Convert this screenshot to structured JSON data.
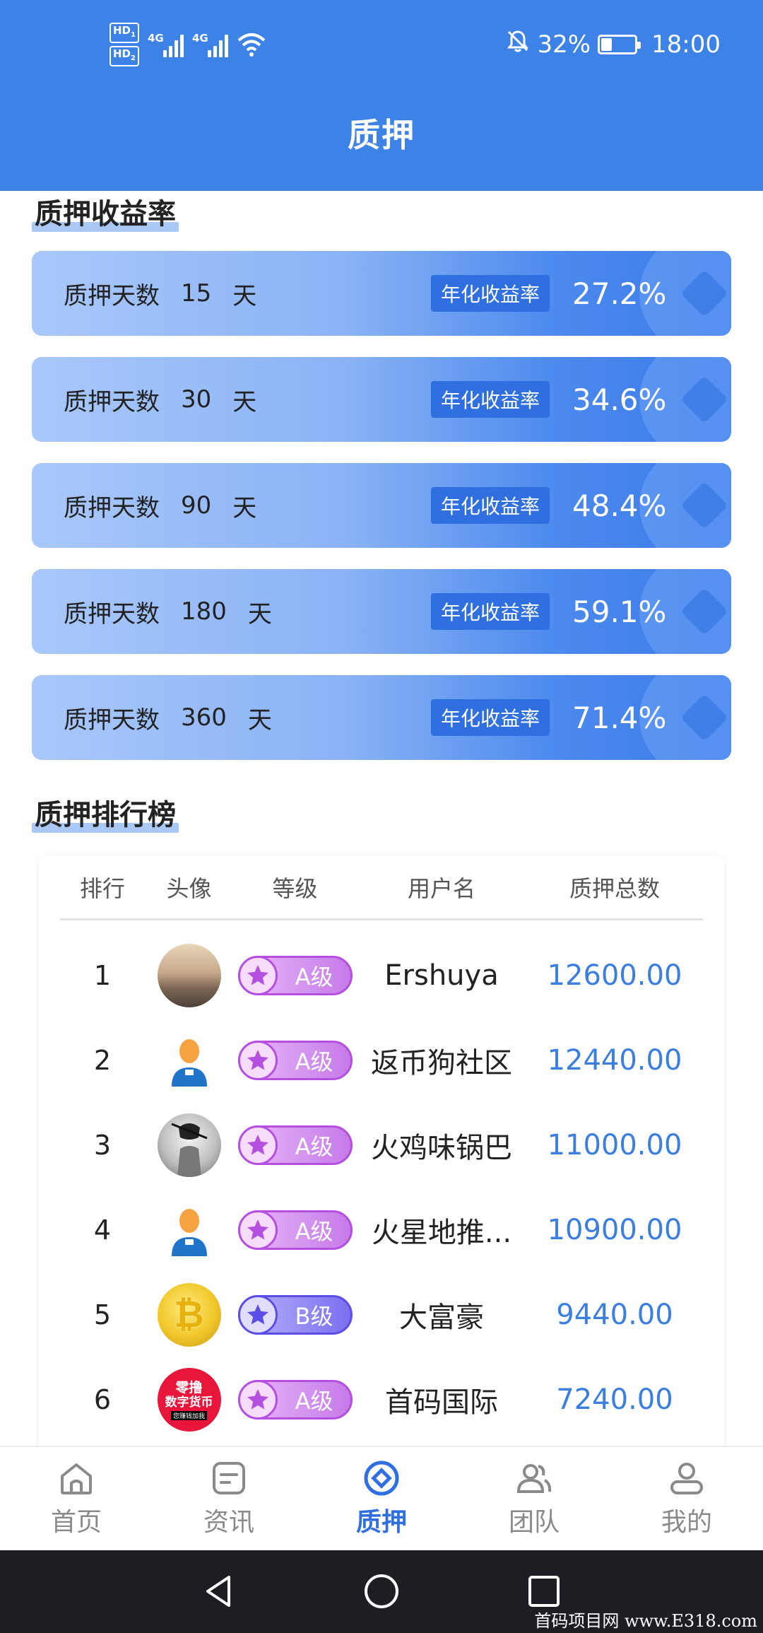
{
  "status_bar": {
    "hd1": "HD",
    "hd1_sub": "1",
    "hd2": "HD",
    "hd2_sub": "2",
    "net1": "4G",
    "net2": "4G",
    "battery": "32%",
    "battery_level": 0.32,
    "time": "18:00",
    "icons": [
      "signal-icon",
      "wifi-icon",
      "mute-bell-icon",
      "battery-icon"
    ]
  },
  "header": {
    "title": "质押"
  },
  "yield_section": {
    "title": "质押收益率",
    "days_label": "质押天数",
    "unit": "天",
    "badge": "年化收益率",
    "items": [
      {
        "days": "15",
        "rate": "27.2%"
      },
      {
        "days": "30",
        "rate": "34.6%"
      },
      {
        "days": "90",
        "rate": "48.4%"
      },
      {
        "days": "180",
        "rate": "59.1%"
      },
      {
        "days": "360",
        "rate": "71.4%"
      }
    ]
  },
  "ranking_section": {
    "title": "质押排行榜",
    "columns": [
      "排行",
      "头像",
      "等级",
      "用户名",
      "质押总数"
    ],
    "rows": [
      {
        "rank": "1",
        "avatar": "photo",
        "level": "A级",
        "name": "Ershuya",
        "total": "12600.00"
      },
      {
        "rank": "2",
        "avatar": "person",
        "level": "A级",
        "name": "返币狗社区",
        "total": "12440.00"
      },
      {
        "rank": "3",
        "avatar": "dark",
        "level": "A级",
        "name": "火鸡味锅巴",
        "total": "11000.00"
      },
      {
        "rank": "4",
        "avatar": "person",
        "level": "A级",
        "name": "火星地推...",
        "total": "10900.00"
      },
      {
        "rank": "5",
        "avatar": "coin",
        "level": "B级",
        "name": "大富豪",
        "total": "9440.00"
      },
      {
        "rank": "6",
        "avatar": "red",
        "level": "A级",
        "name": "首码国际",
        "total": "7240.00"
      }
    ],
    "coin_glyph": "₿",
    "red_avatar_lines": [
      "零撸",
      "数字货币",
      "您赚钱加我"
    ]
  },
  "bottom_nav": {
    "items": [
      {
        "label": "首页",
        "icon": "home-icon",
        "active": false
      },
      {
        "label": "资讯",
        "icon": "news-icon",
        "active": false
      },
      {
        "label": "质押",
        "icon": "stake-icon",
        "active": true
      },
      {
        "label": "团队",
        "icon": "team-icon",
        "active": false
      },
      {
        "label": "我的",
        "icon": "profile-icon",
        "active": false
      }
    ]
  },
  "watermark": "首码项目网 www.E318.com",
  "colors": {
    "header": "#3d82e6",
    "accent": "#2f6fe0",
    "value": "#3a7fe0"
  }
}
